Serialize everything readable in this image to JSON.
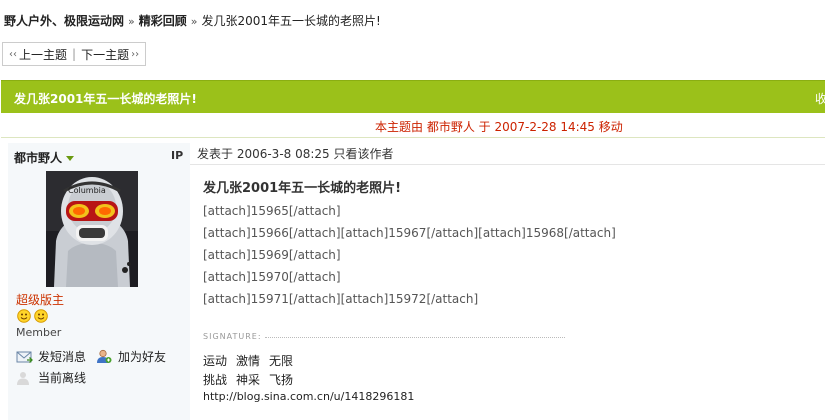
{
  "breadcrumb": {
    "forum": "野人户外、极限运动网",
    "section": "精彩回顾",
    "topic": "发几张2001年五一长城的老照片!"
  },
  "topic_nav": {
    "prev": "上一主题",
    "next": "下一主题"
  },
  "thread": {
    "title": "发几张2001年五一长城的老照片!",
    "favorite": "收",
    "origin_note": "本主题由 都市野人 于 2007-2-28 14:45 移动"
  },
  "author": {
    "name": "都市野人",
    "ip": "IP",
    "role": "超级版主",
    "group": "Member",
    "send_message": "发短消息",
    "add_friend": "加为好友",
    "status": "当前离线"
  },
  "post": {
    "posted_at": "发表于  2006-3-8 08:25  只看该作者",
    "title": "发几张2001年五一长城的老照片!",
    "lines": [
      "[attach]15965[/attach]",
      "[attach]15966[/attach][attach]15967[/attach][attach]15968[/attach]",
      "[attach]15969[/attach]",
      "[attach]15970[/attach]",
      "[attach]15971[/attach][attach]15972[/attach]"
    ],
    "signature_label": "SIGNATURE:",
    "signature_line1": [
      "运动",
      "激情",
      "无限"
    ],
    "signature_line2": [
      "挑战",
      "神采",
      "飞扬"
    ],
    "signature_url": "http://blog.sina.com.cn/u/1418296181"
  },
  "colors": {
    "title_bar": "#9bc11a",
    "role": "#cc3300",
    "origin": "#cc2200"
  }
}
